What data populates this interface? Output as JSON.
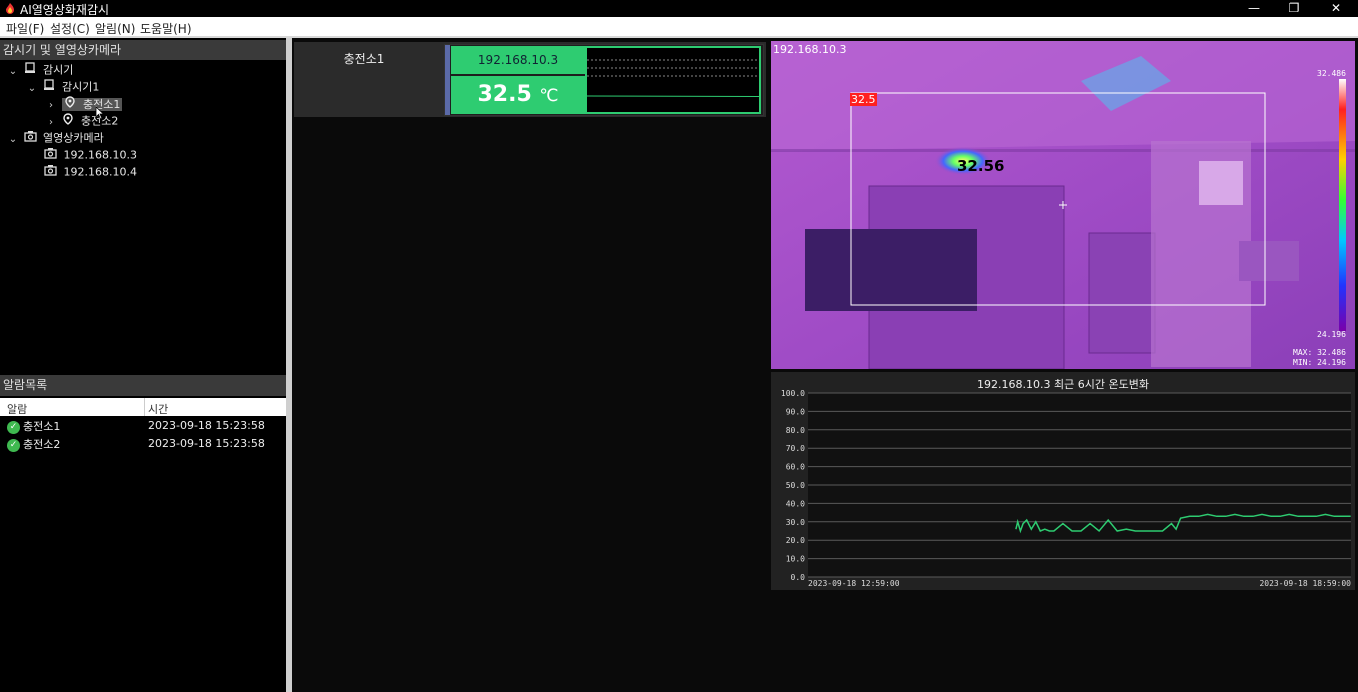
{
  "titlebar": {
    "title": "AI열영상화재감시",
    "min": "—",
    "max": "❐",
    "close": "✕"
  },
  "menu": [
    "파일(F)",
    "설정(C)",
    "알림(N)",
    "도움말(H)"
  ],
  "left": {
    "tree_header": "감시기 및 열영상카메라",
    "tree": {
      "monitor_root": "감시기",
      "monitor_1": "감시기1",
      "station_1": "충전소1",
      "station_2": "충전소2",
      "camera_root": "열영상카메라",
      "camera_1": "192.168.10.3",
      "camera_2": "192.168.10.4"
    },
    "alarm_header": "알람목록",
    "alarm_columns": [
      "알람",
      "시간"
    ],
    "alarms": [
      {
        "name": "충전소1",
        "time": "2023-09-18 15:23:58"
      },
      {
        "name": "충전소2",
        "time": "2023-09-18 15:23:58"
      }
    ]
  },
  "station_card": {
    "name": "충전소1",
    "camera_ip": "192.168.10.3",
    "temperature": "32.5",
    "unit": "℃"
  },
  "thermal": {
    "ip": "192.168.10.3",
    "roi_label": "32.5",
    "hotspot": "32.56",
    "scale_max": "32.486",
    "scale_min": "24.196",
    "max_label": "MAX: 32.486",
    "min_label": "MIN: 24.196"
  },
  "colors": {
    "accent_green": "#2ecc71",
    "alarm_red": "#ff2020",
    "chart_line": "#2ecc71"
  },
  "chart_data": {
    "type": "line",
    "title": "192.168.10.3 최근 6시간 온도변화",
    "ylim": [
      0,
      100
    ],
    "yticks": [
      "100.0",
      "90.0",
      "80.0",
      "70.0",
      "60.0",
      "50.0",
      "40.0",
      "30.0",
      "20.0",
      "10.0",
      "0.0"
    ],
    "x_start_label": "2023-09-18 12:59:00",
    "x_end_label": "2023-09-18 18:59:00",
    "x_start_hour": 12.983,
    "x_end_hour": 18.983,
    "grid": true,
    "series": [
      {
        "x": [
          15.28,
          15.3,
          15.33,
          15.36,
          15.4,
          15.45,
          15.5,
          15.55,
          15.6,
          15.65,
          15.7,
          15.8,
          15.9,
          16.0,
          16.1,
          16.2,
          16.3,
          16.4,
          16.5,
          16.6,
          16.7,
          16.8,
          16.9,
          17.0,
          17.05,
          17.1,
          17.2,
          17.3,
          17.4,
          17.5,
          17.6,
          17.7,
          17.8,
          17.9,
          18.0,
          18.1,
          18.2,
          18.3,
          18.4,
          18.5,
          18.6,
          18.7,
          18.8,
          18.9,
          18.98
        ],
        "y": [
          26,
          30,
          25,
          29,
          31,
          26,
          30,
          25,
          26,
          25,
          25,
          29,
          25,
          25,
          29,
          25,
          31,
          25,
          26,
          25,
          25,
          25,
          25,
          29,
          26,
          32,
          33,
          33,
          34,
          33,
          33,
          34,
          33,
          33,
          34,
          33,
          33,
          34,
          33,
          33,
          33,
          34,
          33,
          33,
          33
        ]
      }
    ]
  }
}
